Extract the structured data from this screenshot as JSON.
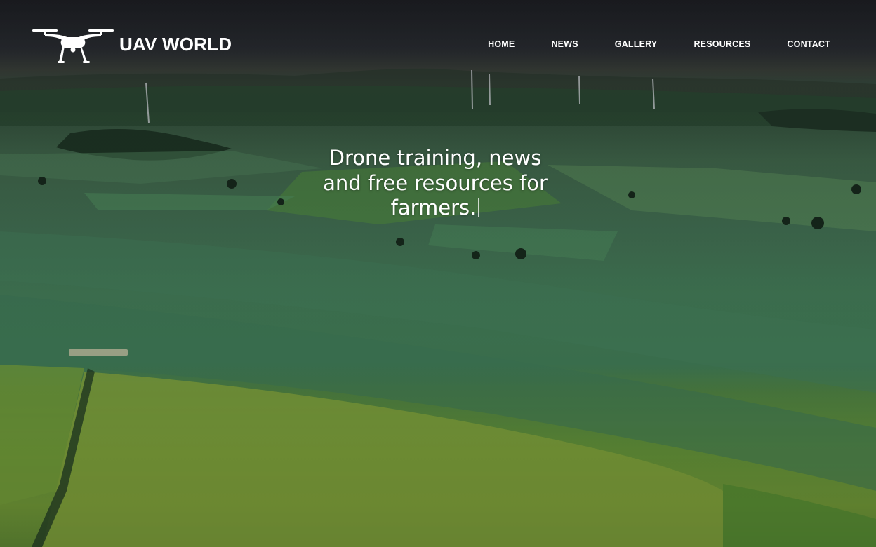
{
  "site": {
    "brand_name": "UAV WORLD",
    "logo_icon": "drone-icon"
  },
  "nav": {
    "items": [
      {
        "label": "HOME"
      },
      {
        "label": "NEWS"
      },
      {
        "label": "GALLERY"
      },
      {
        "label": "RESOURCES"
      },
      {
        "label": "CONTACT"
      }
    ]
  },
  "hero": {
    "headline_line1": "Drone training, news",
    "headline_line2": "and free resources for",
    "headline_line3": "farmers.",
    "background": "aerial-farmland-photo"
  },
  "colors": {
    "text": "#ffffff",
    "field_dark": "#3c7350",
    "field_light": "#6a8f34",
    "sky": "#2c3034"
  }
}
